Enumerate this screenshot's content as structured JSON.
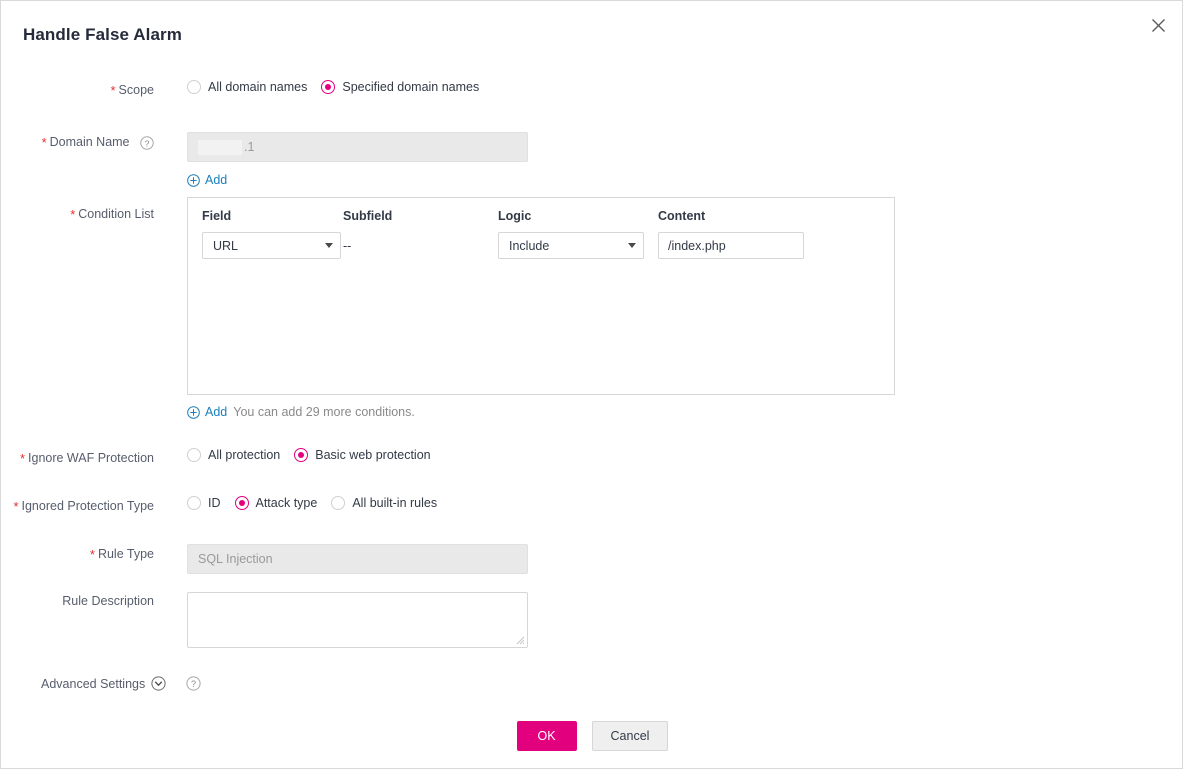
{
  "dialog": {
    "title": "Handle False Alarm",
    "close_icon": "close-icon"
  },
  "scope": {
    "label": "Scope",
    "required": "*",
    "options": [
      {
        "label": "All domain names",
        "checked": false
      },
      {
        "label": "Specified domain names",
        "checked": true
      }
    ]
  },
  "domain_name": {
    "label": "Domain Name",
    "required": "*",
    "help_icon": "help-icon",
    "value": ".1",
    "add_link": "Add"
  },
  "condition_list": {
    "label": "Condition List",
    "required": "*",
    "columns": {
      "field": "Field",
      "subfield": "Subfield",
      "logic": "Logic",
      "content": "Content"
    },
    "rows": [
      {
        "field": "URL",
        "subfield": "--",
        "logic": "Include",
        "content": "/index.php"
      }
    ],
    "add_link": "Add",
    "add_hint": "You can add 29 more conditions."
  },
  "ignore_waf_protection": {
    "label": "Ignore WAF Protection",
    "required": "*",
    "options": [
      {
        "label": "All protection",
        "checked": false
      },
      {
        "label": "Basic web protection",
        "checked": true
      }
    ]
  },
  "ignored_protection_type": {
    "label": "Ignored Protection Type",
    "required": "*",
    "options": [
      {
        "label": "ID",
        "checked": false
      },
      {
        "label": "Attack type",
        "checked": true
      },
      {
        "label": "All built-in rules",
        "checked": false
      }
    ]
  },
  "rule_type": {
    "label": "Rule Type",
    "required": "*",
    "value": "SQL Injection"
  },
  "rule_description": {
    "label": "Rule Description",
    "value": ""
  },
  "advanced_settings": {
    "label": "Advanced Settings",
    "expander_icon": "chevron-down-circle-icon",
    "help_icon": "help-icon"
  },
  "footer": {
    "ok_label": "OK",
    "cancel_label": "Cancel"
  },
  "colors": {
    "accent": "#e3007f",
    "link": "#1b7fbb",
    "required": "#e62e2e",
    "label_text": "#575d6c",
    "value_text": "#333a47"
  }
}
